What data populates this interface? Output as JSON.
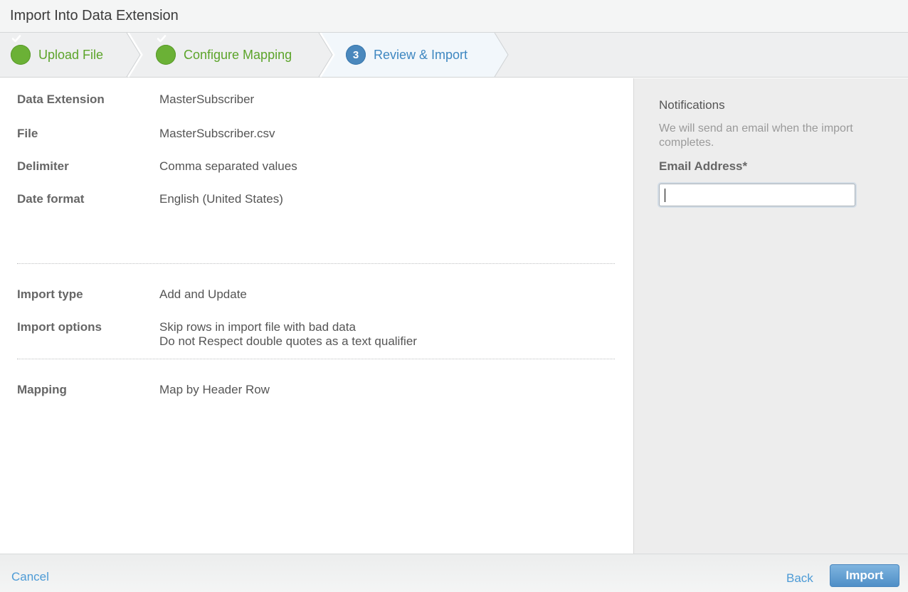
{
  "dialog": {
    "title": "Import Into Data Extension"
  },
  "steps": [
    {
      "label": "Upload File",
      "status": "complete",
      "icon": "check-icon"
    },
    {
      "label": "Configure Mapping",
      "status": "complete",
      "icon": "check-icon"
    },
    {
      "label": "Review & Import",
      "status": "current",
      "number": "3"
    }
  ],
  "summary": {
    "data_extension": {
      "label": "Data Extension",
      "value": "MasterSubscriber"
    },
    "file": {
      "label": "File",
      "value": "MasterSubscriber.csv"
    },
    "delimiter": {
      "label": "Delimiter",
      "value": "Comma separated values"
    },
    "date_format": {
      "label": "Date format",
      "value": "English (United States)"
    },
    "import_type": {
      "label": "Import type",
      "value": "Add and Update"
    },
    "import_options": {
      "label": "Import options",
      "values": [
        "Skip rows in import file with bad data",
        "Do not Respect double quotes as a text qualifier"
      ]
    },
    "mapping": {
      "label": "Mapping",
      "value": "Map by Header Row"
    }
  },
  "notifications": {
    "title": "Notifications",
    "description": "We will send an email when the import completes.",
    "email_label": "Email Address*",
    "email_value": "",
    "email_placeholder": ""
  },
  "footer": {
    "cancel": "Cancel",
    "back": "Back",
    "import": "Import"
  },
  "colors": {
    "complete": "#6bb136",
    "current": "#4a88bd",
    "link": "#4d9bd6"
  }
}
